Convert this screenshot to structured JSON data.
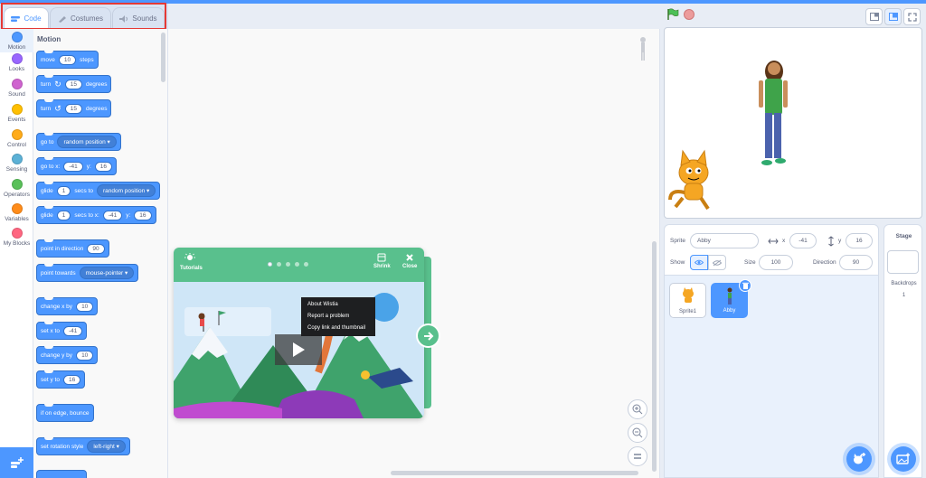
{
  "tabs": [
    {
      "label": "Code",
      "icon": "code-icon"
    },
    {
      "label": "Costumes",
      "icon": "brush-icon"
    },
    {
      "label": "Sounds",
      "icon": "speaker-icon"
    }
  ],
  "categories": [
    {
      "label": "Motion",
      "color": "#4c97ff"
    },
    {
      "label": "Looks",
      "color": "#9966ff"
    },
    {
      "label": "Sound",
      "color": "#cf63cf"
    },
    {
      "label": "Events",
      "color": "#ffbf00"
    },
    {
      "label": "Control",
      "color": "#ffab19"
    },
    {
      "label": "Sensing",
      "color": "#5cb1d6"
    },
    {
      "label": "Operators",
      "color": "#59c059"
    },
    {
      "label": "Variables",
      "color": "#ff8c1a"
    },
    {
      "label": "My Blocks",
      "color": "#ff6680"
    }
  ],
  "palette": {
    "title": "Motion",
    "blocks": {
      "move": {
        "pre": "move",
        "val": "10",
        "post": "steps"
      },
      "turn_right": {
        "pre": "turn",
        "val": "15",
        "post": "degrees"
      },
      "turn_left": {
        "pre": "turn",
        "val": "15",
        "post": "degrees"
      },
      "goto": {
        "pre": "go to",
        "drop": "random position"
      },
      "gotoxy": {
        "pre": "go to x:",
        "x": "-41",
        "mid": "y:",
        "y": "16"
      },
      "glide_to": {
        "pre": "glide",
        "val": "1",
        "mid": "secs to",
        "drop": "random position"
      },
      "glide_xy": {
        "pre": "glide",
        "val": "1",
        "mid": "secs to x:",
        "x": "-41",
        "ylbl": "y:",
        "y": "16"
      },
      "point_dir": {
        "pre": "point in direction",
        "val": "90"
      },
      "point_towards": {
        "pre": "point towards",
        "drop": "mouse-pointer"
      },
      "change_x": {
        "pre": "change x by",
        "val": "10"
      },
      "set_x": {
        "pre": "set x to",
        "val": "-41"
      },
      "change_y": {
        "pre": "change y by",
        "val": "10"
      },
      "set_y": {
        "pre": "set y to",
        "val": "16"
      },
      "bounce": {
        "pre": "if on edge, bounce"
      },
      "rotation": {
        "pre": "set rotation style",
        "drop": "left-right"
      }
    }
  },
  "tutorial": {
    "tutorials_label": "Tutorials",
    "shrink_label": "Shrink",
    "close_label": "Close",
    "context_menu": [
      "About Wistia",
      "Report a problem",
      "Copy link and thumbnail"
    ]
  },
  "sprite_info": {
    "sprite_label": "Sprite",
    "sprite_name": "Abby",
    "x_label": "x",
    "x": "-41",
    "y_label": "y",
    "y": "16",
    "show_label": "Show",
    "size_label": "Size",
    "size": "100",
    "direction_label": "Direction",
    "direction": "90"
  },
  "sprites": [
    {
      "name": "Sprite1",
      "selected": false
    },
    {
      "name": "Abby",
      "selected": true
    }
  ],
  "stage_panel": {
    "title": "Stage",
    "backdrops_label": "Backdrops",
    "backdrops_count": "1"
  },
  "colors": {
    "motion": "#4c97ff",
    "accent": "#4d97ff",
    "tutorial_green": "#59c08d",
    "highlight_red": "#e53935"
  }
}
